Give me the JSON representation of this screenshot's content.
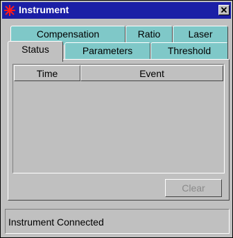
{
  "window": {
    "title": "Instrument",
    "close_label": "✕",
    "title_bar_color": "#1b1fa6",
    "icon": "red-starburst-icon"
  },
  "tabs": {
    "back_row": [
      "Compensation",
      "Ratio",
      "Laser"
    ],
    "front_row": [
      "Status",
      "Parameters",
      "Threshold"
    ],
    "selected": "Status",
    "inactive_color": "#7fc8c8"
  },
  "table": {
    "columns": [
      "Time",
      "Event"
    ],
    "rows": []
  },
  "buttons": {
    "clear_label": "Clear",
    "clear_enabled": false
  },
  "status": {
    "text": "Instrument Connected"
  }
}
